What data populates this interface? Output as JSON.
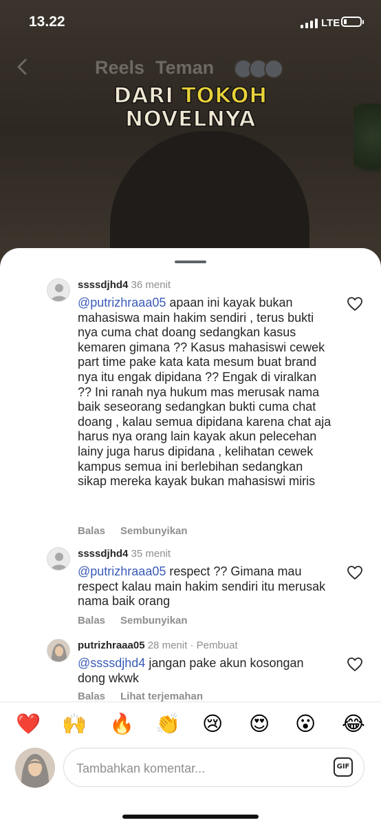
{
  "status_bar": {
    "time": "13.22",
    "network": "LTE",
    "battery_level": 0.2
  },
  "background": {
    "tabs": [
      "Reels",
      "Teman"
    ],
    "overlay_line1_a": "DARI ",
    "overlay_line1_b": "TOKOH",
    "overlay_line2": "NOVELNYA"
  },
  "comments": [
    {
      "username": "ssssdjhd4",
      "time": "36 menit",
      "creator_tag": "",
      "mention": "@putrizhraaa05",
      "text": " apaan ini kayak bukan mahasiswa main hakim sendiri , terus bukti nya cuma chat doang sedangkan kasus kemaren gimana ?? Kasus mahasiswi cewek part time pake kata kata mesum buat brand nya itu engak dipidana ?? Engak di viralkan ?? Ini ranah nya hukum mas merusak nama baik seseorang sedangkan bukti cuma chat doang , kalau semua dipidana karena chat aja harus nya orang lain kayak akun pelecehan lainy juga harus dipidana , kelihatan cewek kampus semua ini berlebihan sedangkan sikap mereka kayak bukan mahasiswi miris",
      "actions": [
        "Balas",
        "Sembunyikan"
      ],
      "avatar_icon": "default-avatar-icon"
    },
    {
      "username": "ssssdjhd4",
      "time": "35 menit",
      "creator_tag": "",
      "mention": "@putrizhraaa05",
      "text": " respect ?? Gimana  mau respect kalau main hakim sendiri itu merusak nama baik orang",
      "actions": [
        "Balas",
        "Sembunyikan"
      ],
      "avatar_icon": "default-avatar-icon"
    },
    {
      "username": "putrizhraaa05",
      "time": "28 menit",
      "creator_tag": "· Pembuat",
      "mention": "@ssssdjhd4",
      "text": " jangan pake akun kosongan dong wkwk",
      "actions": [
        "Balas",
        "Lihat terjemahan"
      ],
      "avatar_icon": "profile-photo"
    }
  ],
  "emoji_bar": [
    "❤️",
    "🙌",
    "🔥",
    "👏",
    "😢",
    "😍",
    "😮",
    "😂"
  ],
  "composer": {
    "placeholder": "Tambahkan komentar...",
    "gif_label": "GIF"
  },
  "colors": {
    "mention": "#3a5bb8",
    "secondary_text": "#8e8e8e",
    "primary_text": "#262626"
  }
}
